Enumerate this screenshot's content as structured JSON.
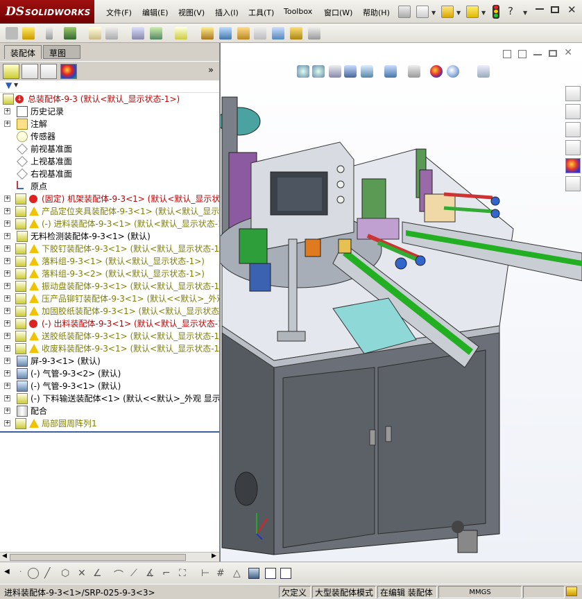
{
  "app": {
    "brand": "SOLIDWORKS",
    "brand_prefix": "DS"
  },
  "menu": {
    "items": [
      "文件(F)",
      "编辑(E)",
      "视图(V)",
      "插入(I)",
      "工具(T)",
      "Toolbox",
      "窗口(W)",
      "帮助(H)"
    ]
  },
  "tabs": {
    "assembly": "装配体",
    "sketch": "草图"
  },
  "tree": {
    "root": "总装配体-9-3  (默认<默认_显示状态-1>)",
    "items": [
      {
        "label": "历史记录",
        "color": "black",
        "icon": "history-icon",
        "expand": true
      },
      {
        "label": "注解",
        "color": "black",
        "icon": "annotation-icon",
        "expand": true
      },
      {
        "label": "传感器",
        "color": "black",
        "icon": "sensor-icon",
        "expand": false
      },
      {
        "label": "前视基准面",
        "color": "black",
        "icon": "plane-icon",
        "expand": false
      },
      {
        "label": "上视基准面",
        "color": "black",
        "icon": "plane-icon",
        "expand": false
      },
      {
        "label": "右视基准面",
        "color": "black",
        "icon": "plane-icon",
        "expand": false
      },
      {
        "label": "原点",
        "color": "black",
        "icon": "origin-icon",
        "expand": false
      },
      {
        "label": "(固定) 机架装配体-9-3<1> (默认<默认_显示状态",
        "color": "red",
        "icon": "error-icon",
        "expand": true
      },
      {
        "label": "产品定位夹具装配体-9-3<1> (默认<默认_显示状",
        "color": "olive",
        "icon": "warning-icon",
        "expand": true
      },
      {
        "label": "(-) 进料装配体-9-3<1> (默认<默认_显示状态-1",
        "color": "olive",
        "icon": "warning-icon",
        "expand": true
      },
      {
        "label": "无料检测装配体-9-3<1> (默认)",
        "color": "black",
        "icon": "assembly-icon",
        "expand": true
      },
      {
        "label": "下胶钉装配体-9-3<1> (默认<默认_显示状态-1>",
        "color": "olive",
        "icon": "warning-icon",
        "expand": true
      },
      {
        "label": "落料组-9-3<1> (默认<默认_显示状态-1>)",
        "color": "olive",
        "icon": "warning-icon",
        "expand": true
      },
      {
        "label": "落料组-9-3<2> (默认<默认_显示状态-1>)",
        "color": "olive",
        "icon": "warning-icon",
        "expand": true
      },
      {
        "label": "振动盘装配体-9-3<1> (默认<默认_显示状态-1>",
        "color": "olive",
        "icon": "warning-icon",
        "expand": true
      },
      {
        "label": "压产品铆钉装配体-9-3<1> (默认<<默认>_外观 显",
        "color": "olive",
        "icon": "warning-icon",
        "expand": true
      },
      {
        "label": "加固胶纸装配体-9-3<1> (默认<默认_显示状态-1",
        "color": "olive",
        "icon": "warning-icon",
        "expand": true
      },
      {
        "label": "(-) 出料装配体-9-3<1> (默认<默认_显示状态-1",
        "color": "red",
        "icon": "error-icon",
        "expand": true
      },
      {
        "label": "送胶纸装配体-9-3<1> (默认<默认_显示状态-1>",
        "color": "olive",
        "icon": "warning-icon",
        "expand": true
      },
      {
        "label": "收废料装配体-9-3<1> (默认<默认_显示状态-1>",
        "color": "olive",
        "icon": "warning-icon",
        "expand": true
      },
      {
        "label": "屏-9-3<1> (默认)",
        "color": "black",
        "icon": "part-icon",
        "expand": true
      },
      {
        "label": "(-) 气管-9-3<2> (默认)",
        "color": "black",
        "icon": "part-icon",
        "expand": true
      },
      {
        "label": "(-) 气管-9-3<1> (默认)",
        "color": "black",
        "icon": "part-icon",
        "expand": true
      },
      {
        "label": "(-) 下料输送装配体<1> (默认<<默认>_外观 显示状",
        "color": "black",
        "icon": "assembly-icon",
        "expand": true
      },
      {
        "label": "配合",
        "color": "black",
        "icon": "mate-icon",
        "expand": true
      },
      {
        "label": "局部圆周阵列1",
        "color": "olive",
        "icon": "warning-icon",
        "expand": true
      }
    ]
  },
  "status": {
    "path": "进料装配体-9-3<1>/SRP-025-9-3<3>",
    "definition": "欠定义",
    "large_mode": "大型装配体模式",
    "editing": "在编辑 装配体",
    "units": "MMGS"
  }
}
